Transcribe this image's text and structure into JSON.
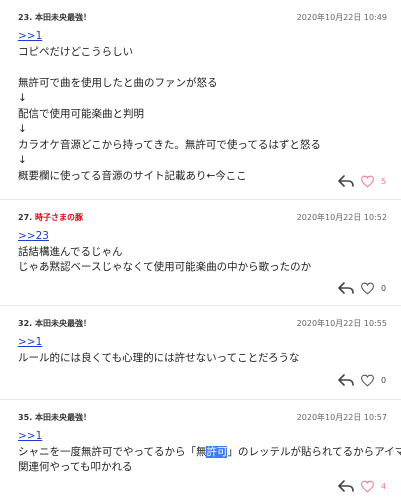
{
  "comments": [
    {
      "num": "23.",
      "author": "本田未央最強！",
      "author_color": "#333333",
      "date": "2020年10月22日 10:49",
      "reply": ">>1",
      "lines": [
        "コピペだけどこうらしい",
        "",
        "無許可で曲を使用したと曲のファンが怒る",
        "↓",
        "配信で使用可能楽曲と判明",
        "↓",
        "カラオケ音源どこから持ってきた。無許可で使ってるはずと怒る",
        "↓",
        "概要欄に使ってる音源のサイト記載あり←今ここ"
      ],
      "likes": "5",
      "liked": true
    },
    {
      "num": "27.",
      "author": "時子さまの豚",
      "author_color": "#e60012",
      "date": "2020年10月22日 10:52",
      "reply": ">>23",
      "lines": [
        "話結構進んでるじゃん",
        "じゃあ黙認ベースじゃなくて使用可能楽曲の中から歌ったのか"
      ],
      "likes": "0",
      "liked": false
    },
    {
      "num": "32.",
      "author": "本田未央最強！",
      "author_color": "#333333",
      "date": "2020年10月22日 10:55",
      "reply": ">>1",
      "lines": [
        "ルール的には良くても心理的には許せないってことだろうな"
      ],
      "likes": "0",
      "liked": false
    },
    {
      "num": "35.",
      "author": "本田未央最強！",
      "author_color": "#333333",
      "date": "2020年10月22日 10:57",
      "reply": ">>1",
      "line1_before": "シャニを一度無許可でやってるから「無",
      "line1_selected": "許可",
      "line1_after": "」のレッテルが貼られてるからアイマス",
      "lines_rest": [
        "関連何やっても叩かれる"
      ],
      "likes": "4",
      "liked": true
    }
  ],
  "icons": {
    "reply": "reply-arrow-icon",
    "like": "heart-icon"
  },
  "colors": {
    "link": "#1a3fd0",
    "like_active": "#f07a9a",
    "selection": "#3b7df0"
  }
}
